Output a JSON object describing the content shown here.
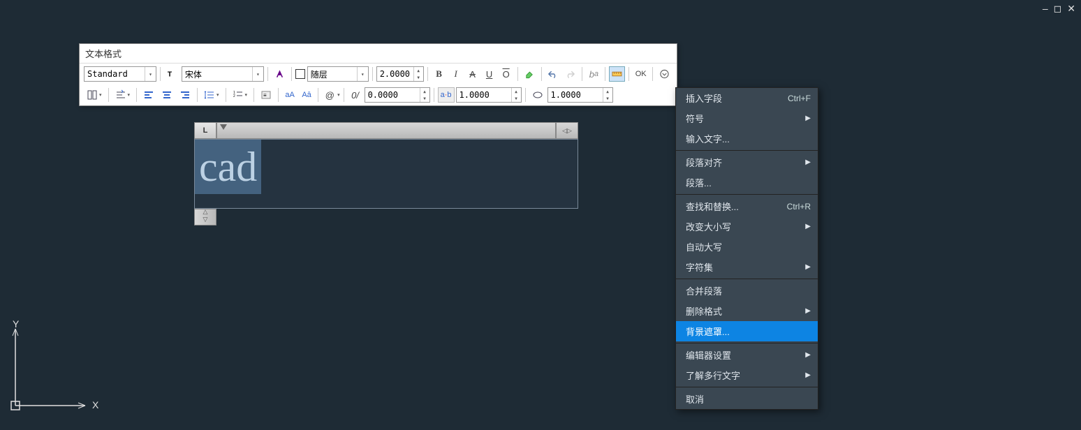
{
  "window": {
    "min": "–",
    "max": "◻",
    "close": "✕"
  },
  "panel": {
    "title": "文本格式",
    "style_name": "Standard",
    "font_name": "宋体",
    "layer_label": "随层",
    "text_height": "2.0000",
    "ok_label": "OK",
    "tracking": "0.0000",
    "width_prefix": "a|b",
    "width_factor": "1.0000",
    "oblique_prefix": "O",
    "oblique": "1.0000",
    "at_symbol": "@",
    "slash_symbol": "0/",
    "case_aa": "aA",
    "case_Aa": "Aā"
  },
  "editor": {
    "ruler_tab": "L",
    "selected_text": "cad"
  },
  "menu": {
    "items": [
      {
        "label": "插入字段",
        "shortcut": "Ctrl+F",
        "sub": false
      },
      {
        "label": "符号",
        "shortcut": "",
        "sub": true
      },
      {
        "label": "输入文字...",
        "shortcut": "",
        "sub": false
      },
      {
        "sep": true
      },
      {
        "label": "段落对齐",
        "shortcut": "",
        "sub": true
      },
      {
        "label": "段落...",
        "shortcut": "",
        "sub": false
      },
      {
        "sep": true
      },
      {
        "label": "查找和替换...",
        "shortcut": "Ctrl+R",
        "sub": false
      },
      {
        "label": "改变大小写",
        "shortcut": "",
        "sub": true
      },
      {
        "label": "自动大写",
        "shortcut": "",
        "sub": false
      },
      {
        "label": "字符集",
        "shortcut": "",
        "sub": true
      },
      {
        "sep": true
      },
      {
        "label": "合并段落",
        "shortcut": "",
        "sub": false
      },
      {
        "label": "删除格式",
        "shortcut": "",
        "sub": true
      },
      {
        "label": "背景遮罩...",
        "shortcut": "",
        "sub": false,
        "hl": true
      },
      {
        "sep": true
      },
      {
        "label": "编辑器设置",
        "shortcut": "",
        "sub": true
      },
      {
        "label": "了解多行文字",
        "shortcut": "",
        "sub": true
      },
      {
        "sep": true
      },
      {
        "label": "取消",
        "shortcut": "",
        "sub": false
      }
    ]
  },
  "axis": {
    "x": "X",
    "y": "Y"
  }
}
